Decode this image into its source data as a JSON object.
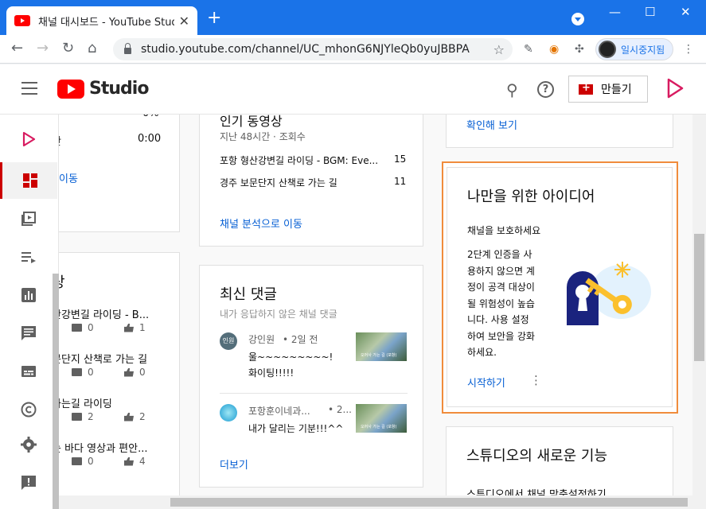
{
  "browser": {
    "tab_title": "채널 대시보드 - YouTube Studio",
    "tab_close": "✕",
    "new_tab": "+",
    "window_controls": [
      "—",
      "☐",
      "✕"
    ],
    "url": "studio.youtube.com/channel/UC_mhonG6NJYleQb0yuJBBPA",
    "profile_label": "일시중지됨"
  },
  "header": {
    "app_name": "Studio",
    "create_label": "만들기"
  },
  "sidebar": {
    "items": [
      {
        "icon": "channel-avatar-icon"
      },
      {
        "icon": "dashboard-icon",
        "active": true
      },
      {
        "icon": "content-icon"
      },
      {
        "icon": "playlists-icon"
      },
      {
        "icon": "analytics-icon"
      },
      {
        "icon": "comments-icon"
      },
      {
        "icon": "subtitles-icon"
      },
      {
        "icon": "copyright-icon"
      },
      {
        "icon": "settings-icon"
      },
      {
        "icon": "feedback-icon"
      }
    ]
  },
  "left_column": {
    "row_values": [
      "0%",
      "0:00"
    ],
    "row_label": "간",
    "move_link": "이동",
    "section_title_fragment": "상",
    "videos": [
      {
        "title": "산강변길 라이딩 - B...",
        "comments": "0",
        "likes": "1"
      },
      {
        "title": "문단지 산책로 가는 길",
        "comments": "0",
        "likes": "0"
      },
      {
        "title": "가는길 라이딩",
        "comments": "2",
        "likes": "2"
      },
      {
        "title": "는 바다 영상과 편안...",
        "comments": "0",
        "likes": "4"
      }
    ]
  },
  "popular": {
    "title": "인기 동영상",
    "subtitle": "지난 48시간 · 조회수",
    "rows": [
      {
        "title": "포항 형산강변길 라이딩 - BGM: Eve...",
        "views": "15"
      },
      {
        "title": "경주 보문단지 산책로 가는 길",
        "views": "11"
      }
    ],
    "link": "채널 분석으로 이동"
  },
  "comments": {
    "title": "최신 댓글",
    "subtitle": "내가 응답하지 않은 채널 댓글",
    "items": [
      {
        "avatar_text": "인원",
        "author": "강인원",
        "time": "• 2일 전",
        "text_line1": "울~~~~~~~~~!",
        "text_line2": "화이팅!!!!!"
      },
      {
        "avatar_text": "",
        "author": "포항훈이네과...",
        "time": "• 2...",
        "text_line1": "내가 달리는 기분!!!^^",
        "text_line2": ""
      }
    ],
    "thumb_caption": "오어사 가는 길 (포항)",
    "more_link": "더보기"
  },
  "top_right": {
    "link": "확인해 보기"
  },
  "ideas": {
    "title": "나만을 위한 아이디어",
    "subtitle": "채널을 보호하세요",
    "body": [
      "2단계 인증을 사",
      "용하지 않으면 계",
      "정이 공격 대상이",
      "될 위험성이 높습",
      "니다. 사용 설정",
      "하여 보안을 강화",
      "하세요."
    ],
    "cta": "시작하기"
  },
  "whats_new": {
    "title": "스튜디오의 새로운 기능",
    "cut_text": "스튜디오에서 채널 맞춤설정하기"
  },
  "colors": {
    "accent_blue": "#065fd4",
    "brand_red": "#ff0000",
    "highlight_orange": "#f08c3c",
    "titlebar_blue": "#1a73e8"
  }
}
